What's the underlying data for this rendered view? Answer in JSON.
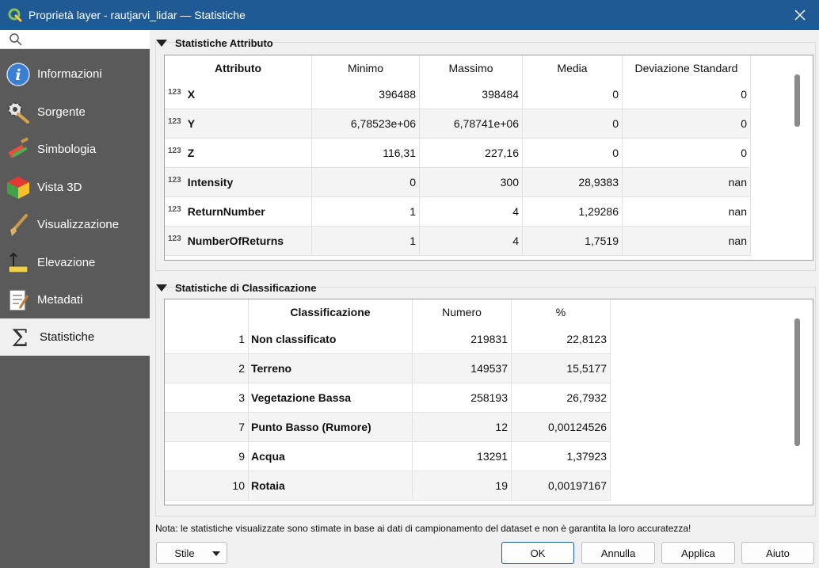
{
  "window": {
    "title": "Proprietà layer - rautjarvi_lidar — Statistiche"
  },
  "sidebar": {
    "items": [
      {
        "label": "Informazioni",
        "icon": "info-icon"
      },
      {
        "label": "Sorgente",
        "icon": "source-gear-icon"
      },
      {
        "label": "Simbologia",
        "icon": "symbology-brush-icon"
      },
      {
        "label": "Vista 3D",
        "icon": "cube-3d-icon"
      },
      {
        "label": "Visualizzazione",
        "icon": "display-brush-icon"
      },
      {
        "label": "Elevazione",
        "icon": "elevation-icon"
      },
      {
        "label": "Metadati",
        "icon": "metadata-icon"
      },
      {
        "label": "Statistiche",
        "icon": "sigma-icon"
      }
    ]
  },
  "attr_stats": {
    "title": "Statistiche Attributo",
    "headers": [
      "Attributo",
      "Minimo",
      "Massimo",
      "Media",
      "Deviazione Standard"
    ],
    "type_label": "123",
    "rows": [
      {
        "name": "X",
        "min": "396488",
        "max": "398484",
        "mean": "0",
        "std": "0"
      },
      {
        "name": "Y",
        "min": "6,78523e+06",
        "max": "6,78741e+06",
        "mean": "0",
        "std": "0"
      },
      {
        "name": "Z",
        "min": "116,31",
        "max": "227,16",
        "mean": "0",
        "std": "0"
      },
      {
        "name": "Intensity",
        "min": "0",
        "max": "300",
        "mean": "28,9383",
        "std": "nan"
      },
      {
        "name": "ReturnNumber",
        "min": "1",
        "max": "4",
        "mean": "1,29286",
        "std": "nan"
      },
      {
        "name": "NumberOfReturns",
        "min": "1",
        "max": "4",
        "mean": "1,7519",
        "std": "nan"
      }
    ]
  },
  "class_stats": {
    "title": "Statistiche di Classificazione",
    "headers": [
      "",
      "Classificazione",
      "Numero",
      "%"
    ],
    "rows": [
      {
        "code": "1",
        "name": "Non classificato",
        "count": "219831",
        "pct": "22,8123"
      },
      {
        "code": "2",
        "name": "Terreno",
        "count": "149537",
        "pct": "15,5177"
      },
      {
        "code": "3",
        "name": "Vegetazione Bassa",
        "count": "258193",
        "pct": "26,7932"
      },
      {
        "code": "7",
        "name": "Punto Basso (Rumore)",
        "count": "12",
        "pct": "0,00124526"
      },
      {
        "code": "9",
        "name": "Acqua",
        "count": "13291",
        "pct": "1,37923"
      },
      {
        "code": "10",
        "name": "Rotaia",
        "count": "19",
        "pct": "0,00197167"
      }
    ]
  },
  "note": "Nota: le statistiche visualizzate sono stimate in base ai dati di campionamento del dataset e non è garantita la loro accuratezza!",
  "buttons": {
    "style": "Stile",
    "ok": "OK",
    "cancel": "Annulla",
    "apply": "Applica",
    "help": "Aiuto"
  },
  "colors": {
    "titlebar": "#1f5a94",
    "sidebar": "#5a5a5a",
    "accent": "#1f5a94"
  }
}
